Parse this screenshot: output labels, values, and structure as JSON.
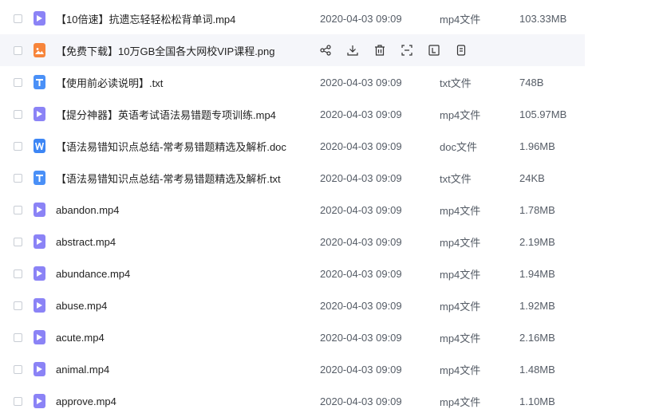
{
  "files": [
    {
      "name": "【10倍速】抗遗忘轻轻松松背单词.mp4",
      "icon": "video-file-icon",
      "date": "2020-04-03 09:09",
      "type": "mp4文件",
      "size": "103.33MB"
    },
    {
      "name": "【免费下载】10万GB全国各大网校VIP课程.png",
      "icon": "image-file-icon",
      "hovered": true,
      "actions": [
        "share-icon",
        "download-icon",
        "delete-icon",
        "scan-icon",
        "text-extract-icon",
        "more-icon"
      ]
    },
    {
      "name": "【使用前必读说明】.txt",
      "icon": "txt-file-icon",
      "date": "2020-04-03 09:09",
      "type": "txt文件",
      "size": "748B"
    },
    {
      "name": "【提分神器】英语考试语法易错题专项训练.mp4",
      "icon": "video-file-icon",
      "date": "2020-04-03 09:09",
      "type": "mp4文件",
      "size": "105.97MB"
    },
    {
      "name": "【语法易错知识点总结-常考易错题精选及解析.doc",
      "icon": "doc-file-icon",
      "date": "2020-04-03 09:09",
      "type": "doc文件",
      "size": "1.96MB"
    },
    {
      "name": "【语法易错知识点总结-常考易错题精选及解析.txt",
      "icon": "txt-file-icon",
      "date": "2020-04-03 09:09",
      "type": "txt文件",
      "size": "24KB"
    },
    {
      "name": "abandon.mp4",
      "icon": "video-file-icon",
      "date": "2020-04-03 09:09",
      "type": "mp4文件",
      "size": "1.78MB"
    },
    {
      "name": "abstract.mp4",
      "icon": "video-file-icon",
      "date": "2020-04-03 09:09",
      "type": "mp4文件",
      "size": "2.19MB"
    },
    {
      "name": "abundance.mp4",
      "icon": "video-file-icon",
      "date": "2020-04-03 09:09",
      "type": "mp4文件",
      "size": "1.94MB"
    },
    {
      "name": "abuse.mp4",
      "icon": "video-file-icon",
      "date": "2020-04-03 09:09",
      "type": "mp4文件",
      "size": "1.92MB"
    },
    {
      "name": "acute.mp4",
      "icon": "video-file-icon",
      "date": "2020-04-03 09:09",
      "type": "mp4文件",
      "size": "2.16MB"
    },
    {
      "name": "animal.mp4",
      "icon": "video-file-icon",
      "date": "2020-04-03 09:09",
      "type": "mp4文件",
      "size": "1.48MB"
    },
    {
      "name": "approve.mp4",
      "icon": "video-file-icon",
      "date": "2020-04-03 09:09",
      "type": "mp4文件",
      "size": "1.10MB"
    }
  ],
  "colors": {
    "video": "#8b83f6",
    "image": "#f7853b",
    "txt": "#4a90f7",
    "doc": "#3d86f5",
    "hover_bg": "#f5f6fa"
  }
}
